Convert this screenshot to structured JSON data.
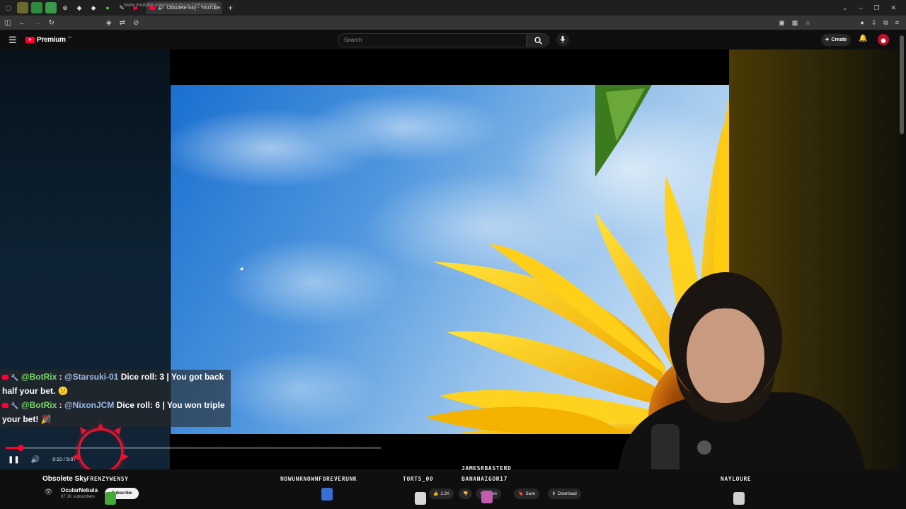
{
  "browser": {
    "tab_title": "Obsolete Sky - YouTube",
    "url": "www.youtube.com/watch?v=g-7XBVXo5eI"
  },
  "youtube": {
    "logo_text": "Premium",
    "logo_sup": "HU",
    "search_placeholder": "Search",
    "create_label": "Create"
  },
  "chat": [
    {
      "user": "@BotRix",
      "sep": " : ",
      "mention": "@Starsuki-01",
      "text": " Dice roll: 3 | You got back half your bet. 😕"
    },
    {
      "user": "@BotRix",
      "sep": " : ",
      "mention": "@NixonJCM",
      "text": " Dice roll: 6 | You won triple your bet! 🎉"
    }
  ],
  "player": {
    "time": "0:10 / 5:07",
    "progress_fraction": 0.033,
    "buffered_fraction": 1.0
  },
  "video_info": {
    "title": "Obsolete Sky",
    "channel": "OcularNebula",
    "subscribers": "67.1K subscribers",
    "subscribe_label": "Subscribe",
    "likes": "2.2K",
    "share_label": "Share",
    "save_label": "Save",
    "download_label": "Download"
  },
  "overlay_viewers": [
    {
      "name": "FRENZYWENSY"
    },
    {
      "name": "NOWUNKNOWNFOREVERUNK"
    },
    {
      "name": "TORTS_00"
    },
    {
      "name": "JAMESRBASTERD"
    },
    {
      "name": "BANANAIGOR17"
    },
    {
      "name": "NAYLOURE"
    }
  ],
  "colors": {
    "accent": "#ff0033",
    "chat_user": "#7bd66b",
    "chat_mention": "#9bb8e8"
  }
}
